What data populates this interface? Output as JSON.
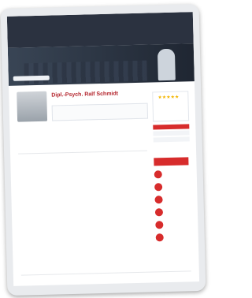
{
  "site": {
    "logo_text": "",
    "contact": "",
    "contact_secondary": ""
  },
  "nav": {
    "items": [
      "",
      "",
      "",
      "",
      ""
    ]
  },
  "search": {
    "placeholder": ""
  },
  "profile": {
    "name": "Dipl.-Psych. Ralf Schmidt",
    "tagline": "",
    "about": "",
    "rating": {
      "stars": "★★★★★",
      "score": ""
    }
  },
  "tabs": [
    "",
    "",
    "",
    "",
    "",
    "",
    ""
  ],
  "columns": {
    "left": {
      "title": "",
      "text": ""
    },
    "right": {
      "title": "",
      "text": ""
    }
  },
  "sidebar": {
    "cta": "",
    "badges": [
      "",
      "",
      "",
      "",
      "",
      ""
    ]
  },
  "footer": {
    "text": ""
  },
  "colors": {
    "brand_red": "#d72c2c",
    "dark_blue": "#2b3240",
    "accent_gold": "#f3b600"
  }
}
